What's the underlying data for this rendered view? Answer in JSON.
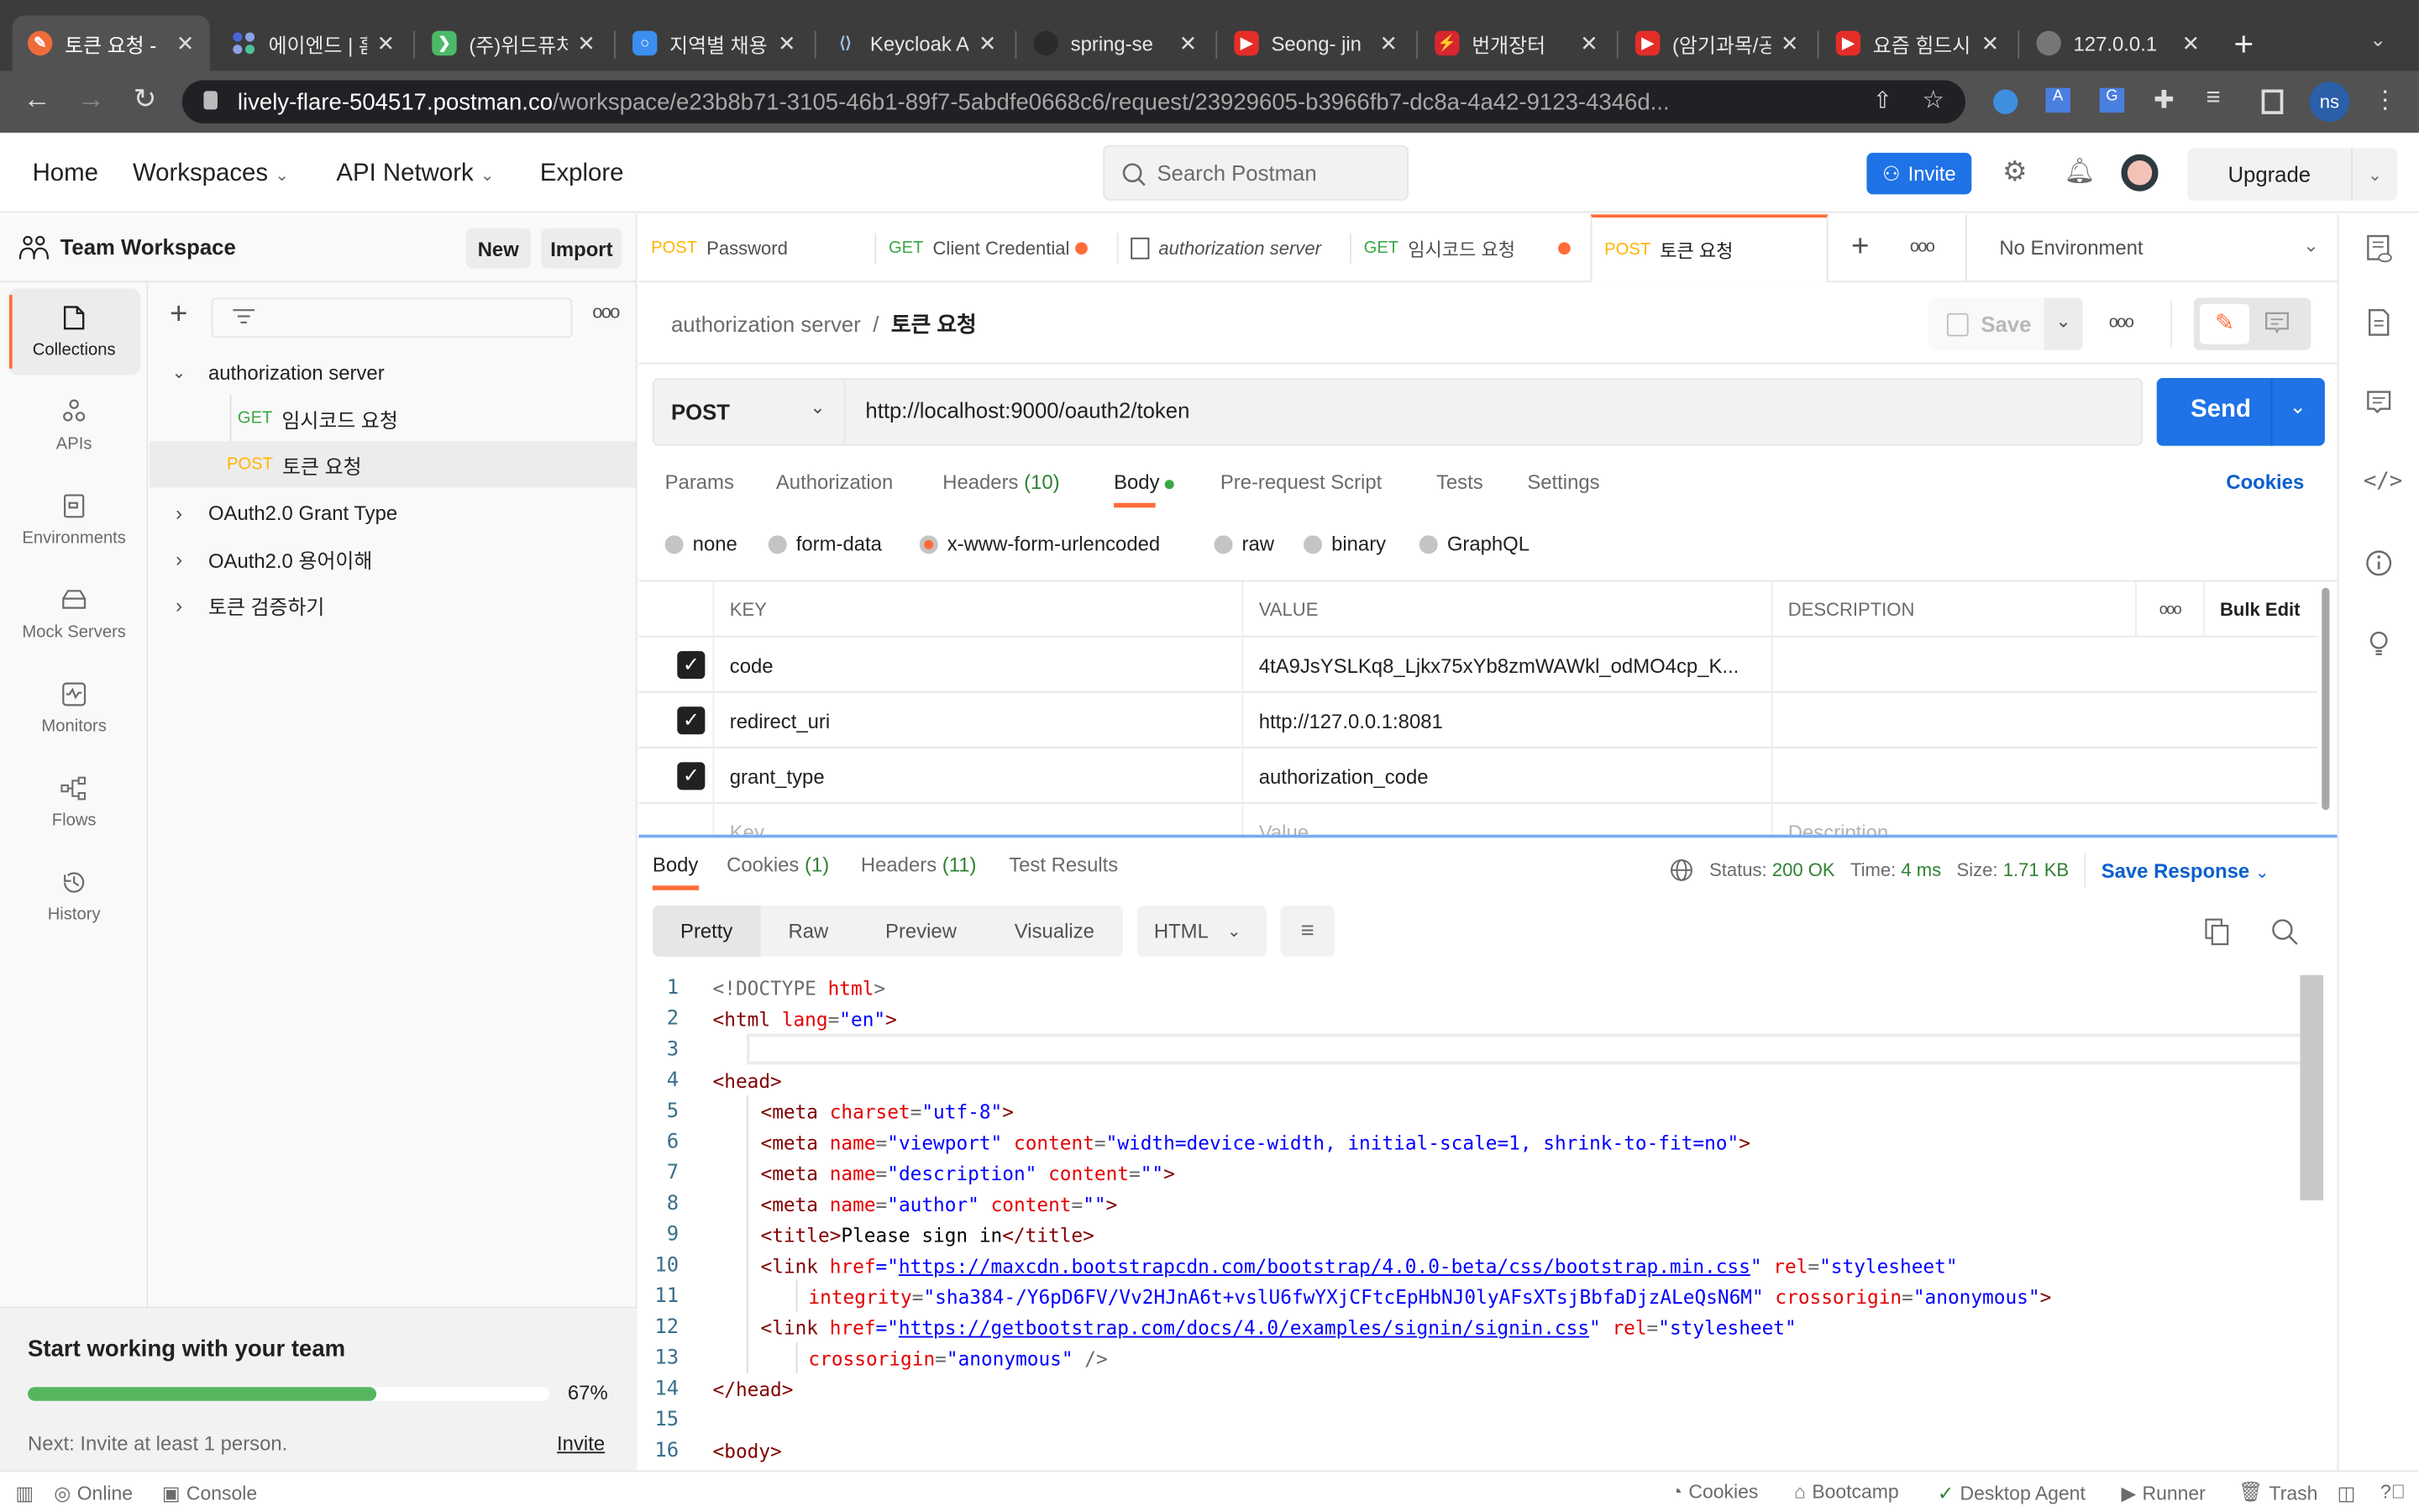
{
  "browser": {
    "tabs": [
      {
        "title": "토큰 요청 -",
        "favicon": "postman-icon",
        "color": "#ef6c3a",
        "active": true
      },
      {
        "title": "에이엔드 | 홈",
        "favicon": "aend-icon",
        "color": "#4a67d9",
        "active": false
      },
      {
        "title": "(주)위드퓨처",
        "favicon": "wanted-icon",
        "color": "#4bba69",
        "active": false
      },
      {
        "title": "지역별 채용",
        "favicon": "saramin-icon",
        "color": "#3c8ef0",
        "active": false
      },
      {
        "title": "Keycloak A",
        "favicon": "keycloak-icon",
        "color": "#8a9bb0",
        "active": false
      },
      {
        "title": "spring-se",
        "favicon": "github-icon",
        "color": "#2b2b2b",
        "active": false
      },
      {
        "title": "Seong- jin",
        "favicon": "youtube-icon",
        "color": "#e52d27",
        "active": false
      },
      {
        "title": "번개장터",
        "favicon": "bunjang-icon",
        "color": "#d7262f",
        "active": false
      },
      {
        "title": "(암기과목/공",
        "favicon": "youtube-icon",
        "color": "#e52d27",
        "active": false
      },
      {
        "title": "요즘 힘드시",
        "favicon": "youtube-icon",
        "color": "#e52d27",
        "active": false
      },
      {
        "title": "127.0.0.1",
        "favicon": "globe-icon",
        "color": "#777777",
        "active": false
      }
    ],
    "url_host": "lively-flare-504517.postman.co",
    "url_path": "/workspace/e23b8b71-3105-46b1-89f7-5abdfe0668c6/request/23929605-b3966fb7-dc8a-4a42-9123-4346d...",
    "profile_initials": "ns"
  },
  "header": {
    "nav": [
      "Home",
      "Workspaces",
      "API Network",
      "Explore"
    ],
    "search_placeholder": "Search Postman",
    "invite_label": "Invite",
    "upgrade_label": "Upgrade"
  },
  "workspace": {
    "name": "Team Workspace",
    "new_label": "New",
    "import_label": "Import"
  },
  "rail": [
    {
      "label": "Collections",
      "icon": "collections-icon",
      "active": true
    },
    {
      "label": "APIs",
      "icon": "apis-icon",
      "active": false
    },
    {
      "label": "Environments",
      "icon": "environments-icon",
      "active": false
    },
    {
      "label": "Mock Servers",
      "icon": "mock-servers-icon",
      "active": false
    },
    {
      "label": "Monitors",
      "icon": "monitors-icon",
      "active": false
    },
    {
      "label": "Flows",
      "icon": "flows-icon",
      "active": false
    },
    {
      "label": "History",
      "icon": "history-icon",
      "active": false
    }
  ],
  "tree": [
    {
      "type": "folder",
      "name": "authorization server",
      "expanded": true
    },
    {
      "type": "request",
      "method": "GET",
      "name": "임시코드 요청"
    },
    {
      "type": "request",
      "method": "POST",
      "name": "토큰 요청",
      "selected": true
    },
    {
      "type": "folder",
      "name": "OAuth2.0 Grant Type",
      "expanded": false
    },
    {
      "type": "folder",
      "name": "OAuth2.0 용어이해",
      "expanded": false
    },
    {
      "type": "folder",
      "name": "토큰 검증하기",
      "expanded": false
    }
  ],
  "team_card": {
    "title": "Start working with your team",
    "progress_percent": 67,
    "progress_label": "67%",
    "next_text": "Next: Invite at least 1 person.",
    "invite_link": "Invite"
  },
  "request_tabs": [
    {
      "method": "POST",
      "name": "Password",
      "unsaved": false
    },
    {
      "method": "GET",
      "name": "Client Credential",
      "unsaved": true
    },
    {
      "method": "",
      "name": "authorization server",
      "unsaved": false,
      "italic": true
    },
    {
      "method": "GET",
      "name": "임시코드 요청",
      "unsaved": true
    },
    {
      "method": "POST",
      "name": "토큰 요청",
      "unsaved": false,
      "active": true
    }
  ],
  "environment": "No Environment",
  "breadcrumb": {
    "parent": "authorization server",
    "separator": "/",
    "current": "토큰 요청"
  },
  "toolbar": {
    "save_label": "Save"
  },
  "request": {
    "method": "POST",
    "url": "http://localhost:9000/oauth2/token",
    "send_label": "Send",
    "tabs": [
      {
        "label": "Params"
      },
      {
        "label": "Authorization"
      },
      {
        "label": "Headers",
        "count": "(10)"
      },
      {
        "label": "Body",
        "active": true
      },
      {
        "label": "Pre-request Script"
      },
      {
        "label": "Tests"
      },
      {
        "label": "Settings"
      }
    ],
    "cookies_label": "Cookies",
    "body_types": [
      "none",
      "form-data",
      "x-www-form-urlencoded",
      "raw",
      "binary",
      "GraphQL"
    ],
    "body_type_selected": "x-www-form-urlencoded",
    "table": {
      "headers": [
        "KEY",
        "VALUE",
        "DESCRIPTION"
      ],
      "bulk_edit": "Bulk Edit",
      "rows": [
        {
          "checked": true,
          "key": "code",
          "value": "4tA9JsYSLKq8_Ljkx75xYb8zmWAWkl_odMO4cp_K...",
          "description": ""
        },
        {
          "checked": true,
          "key": "redirect_uri",
          "value": "http://127.0.0.1:8081",
          "description": ""
        },
        {
          "checked": true,
          "key": "grant_type",
          "value": "authorization_code",
          "description": ""
        }
      ],
      "placeholder": {
        "key": "Key",
        "value": "Value",
        "description": "Description"
      }
    }
  },
  "response": {
    "tabs": [
      {
        "label": "Body",
        "active": true
      },
      {
        "label": "Cookies",
        "count": "(1)"
      },
      {
        "label": "Headers",
        "count": "(11)"
      },
      {
        "label": "Test Results"
      }
    ],
    "status_label": "Status:",
    "status": "200 OK",
    "time_label": "Time:",
    "time": "4 ms",
    "size_label": "Size:",
    "size": "1.71 KB",
    "save_response": "Save Response",
    "formats": [
      "Pretty",
      "Raw",
      "Preview",
      "Visualize"
    ],
    "language": "HTML",
    "code_lines": [
      {
        "n": "1"
      },
      {
        "n": "2"
      },
      {
        "n": "3"
      },
      {
        "n": "4"
      },
      {
        "n": "5"
      },
      {
        "n": "6"
      },
      {
        "n": "7"
      },
      {
        "n": "8"
      },
      {
        "n": "9"
      },
      {
        "n": "10"
      },
      {
        "n": "11"
      },
      {
        "n": "12"
      },
      {
        "n": "13"
      },
      {
        "n": "14"
      },
      {
        "n": "15"
      },
      {
        "n": "16"
      }
    ],
    "code": {
      "l1": [
        "<!DOCTYPE ",
        "html",
        ">"
      ],
      "l2": [
        "<html ",
        "lang",
        "=",
        "\"en\"",
        ">"
      ],
      "l4": [
        "<head>"
      ],
      "l5": [
        "<meta ",
        "charset",
        "=",
        "\"utf-8\"",
        ">"
      ],
      "l6": [
        "<meta ",
        "name",
        "=",
        "\"viewport\"",
        " ",
        "content",
        "=",
        "\"width=device-width, initial-scale=1, shrink-to-fit=no\"",
        ">"
      ],
      "l7": [
        "<meta ",
        "name",
        "=",
        "\"description\"",
        " ",
        "content",
        "=",
        "\"\"",
        ">"
      ],
      "l8": [
        "<meta ",
        "name",
        "=",
        "\"author\"",
        " ",
        "content",
        "=",
        "\"\"",
        ">"
      ],
      "l9": [
        "<title>",
        "Please sign in",
        "</title>"
      ],
      "l10": [
        "<link ",
        "href",
        "=\"",
        "https://maxcdn.bootstrapcdn.com/bootstrap/4.0.0-beta/css/bootstrap.min.css",
        "\" ",
        "rel",
        "=",
        "\"stylesheet\""
      ],
      "l11": [
        "integrity",
        "=",
        "\"sha384-/Y6pD6FV/Vv2HJnA6t+vslU6fwYXjCFtcEpHbNJ0lyAFsXTsjBbfaDjzALeQsN6M\"",
        " ",
        "crossorigin",
        "=",
        "\"anonymous\"",
        ">"
      ],
      "l12": [
        "<link ",
        "href",
        "=\"",
        "https://getbootstrap.com/docs/4.0/examples/signin/signin.css",
        "\" ",
        "rel",
        "=",
        "\"stylesheet\""
      ],
      "l13": [
        "crossorigin",
        "=",
        "\"anonymous\"",
        " />"
      ],
      "l14": [
        "</head>"
      ],
      "l16": [
        "<body>"
      ]
    }
  },
  "statusbar": {
    "left": [
      {
        "label": "Online",
        "icon": "online-icon"
      },
      {
        "label": "Console",
        "icon": "console-icon"
      }
    ],
    "right": [
      {
        "label": "Cookies",
        "icon": "cookie-icon"
      },
      {
        "label": "Bootcamp",
        "icon": "bootcamp-icon"
      },
      {
        "label": "Desktop Agent",
        "icon": "desktop-agent-icon"
      },
      {
        "label": "Runner",
        "icon": "runner-icon"
      },
      {
        "label": "Trash",
        "icon": "trash-icon"
      }
    ]
  },
  "colors": {
    "accent": "#ff6c37",
    "primary_blue": "#1f73e6",
    "get": "#3aa845",
    "post": "#ffb400",
    "progress": "#56b660"
  }
}
